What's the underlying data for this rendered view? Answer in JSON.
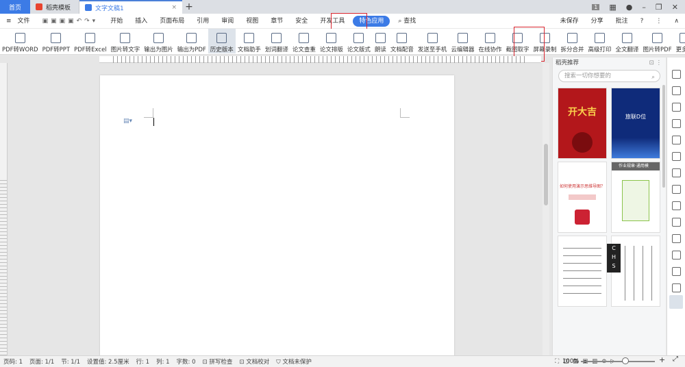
{
  "titlebar": {
    "home": "首页",
    "tab2": "稻壳模板",
    "tab3": "文字文稿1",
    "page_badge": "1"
  },
  "menu": {
    "file": "文件",
    "items": [
      "开始",
      "插入",
      "页面布局",
      "引用",
      "审阅",
      "视图",
      "章节",
      "安全",
      "开发工具",
      "特色应用"
    ],
    "search": "查找",
    "right": [
      "未保存",
      "分享",
      "批注"
    ]
  },
  "toolbar": [
    "PDF转WORD",
    "PDF转PPT",
    "PDF转Excel",
    "图片转文字",
    "输出为图片",
    "输出为PDF",
    "历史版本",
    "文档助手",
    "划词翻译",
    "论文查重",
    "论文排版",
    "论文版式",
    "朗读",
    "文档配音",
    "发送至手机",
    "云编辑器",
    "在线协作",
    "截图取字",
    "屏幕录制",
    "拆分合并",
    "高级打印",
    "全文翻译",
    "图片转PDF",
    "更多应"
  ],
  "panel": {
    "title": "稻壳推荐",
    "search_placeholder": "搜索一切你想要的",
    "cards": [
      {
        "text": "开大吉"
      },
      {
        "text": "旅联D位"
      },
      {
        "text": "如何使用演示思维导图？"
      },
      {
        "text": "作业规章·通用模"
      },
      {
        "text": ""
      },
      {
        "text": ""
      }
    ]
  },
  "statusbar": {
    "page": "页码: 1",
    "pages": "页面: 1/1",
    "section": "节: 1/1",
    "set": "设置值: 2.5厘米",
    "row": "行: 1",
    "col": "列: 1",
    "words": "字数: 0",
    "spell": "拼写检查",
    "proof": "文档校对",
    "protect": "文档未保护",
    "zoom": "100%"
  },
  "chs": [
    "C",
    "H",
    "S"
  ],
  "colors": {
    "accent": "#3c7be6",
    "highlight": "#d9232d"
  }
}
